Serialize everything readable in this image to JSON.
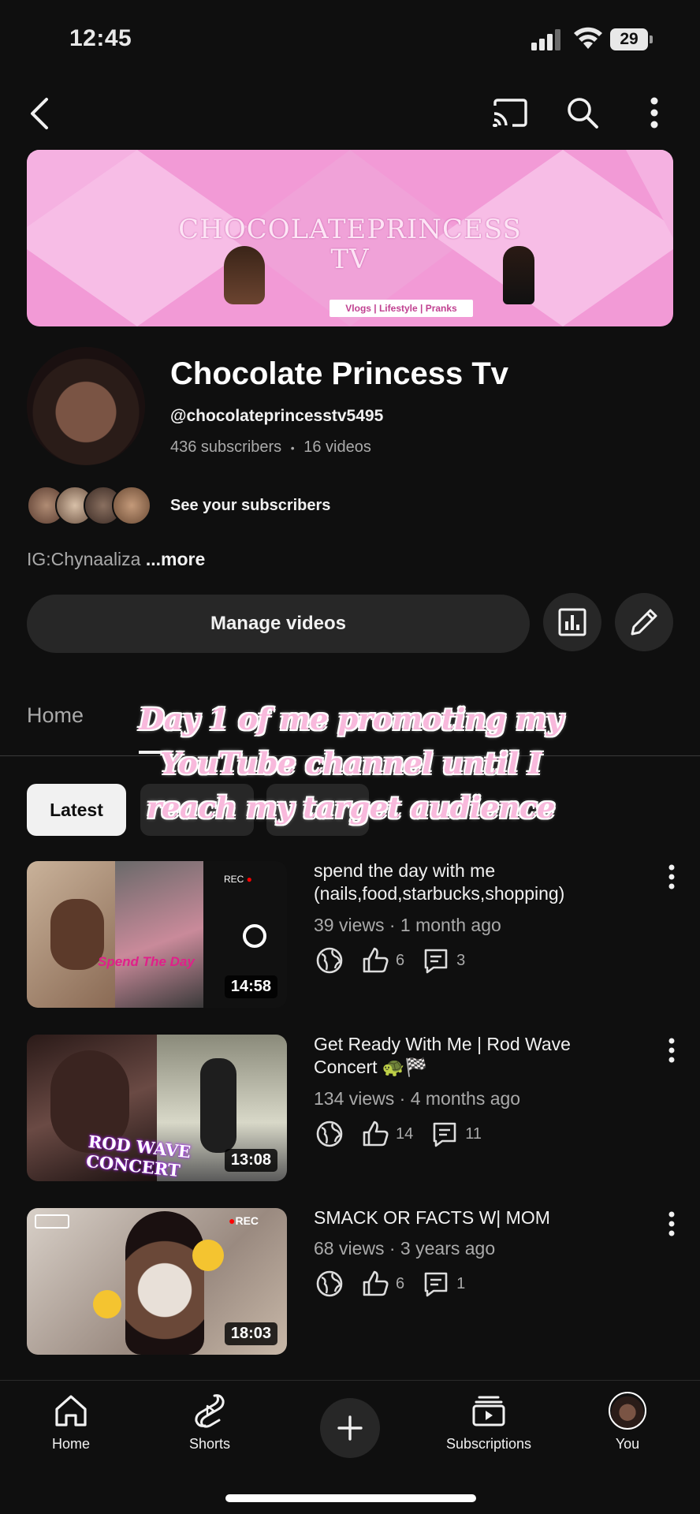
{
  "status_bar": {
    "time": "12:45",
    "battery": "29"
  },
  "banner": {
    "title_line1": "CHOCOLATEPRINCESS",
    "title_line2": "TV",
    "tagline": "Vlogs | Lifestyle | Pranks"
  },
  "channel": {
    "name": "Chocolate Princess Tv",
    "handle": "@chocolateprincesstv5495",
    "subscribers": "436 subscribers",
    "separator": "•",
    "videos_count": "16 videos",
    "see_subscribers": "See your subscribers",
    "description": "IG:Chynaaliza",
    "more": "...more"
  },
  "actions": {
    "manage_videos": "Manage videos"
  },
  "tabs": {
    "home": "Home"
  },
  "chips": {
    "latest": "Latest"
  },
  "overlay_caption": {
    "line1": "Day 1 of me promoting my",
    "line2": "YouTube channel until I",
    "line3": "reach my target audience"
  },
  "videos": [
    {
      "title": "spend the day with me (nails,food,starbucks,shopping)",
      "meta": "39 views · 1 month ago",
      "likes": "6",
      "comments": "3",
      "duration": "14:58",
      "overlay_text": "Spend The Day"
    },
    {
      "title": "Get Ready With Me | Rod Wave Concert 🐢🏁",
      "meta": "134 views · 4 months ago",
      "likes": "14",
      "comments": "11",
      "duration": "13:08",
      "overlay_text": "ROD WAVE CONCERT"
    },
    {
      "title": "SMACK OR FACTS W| MOM",
      "meta": "68 views · 3 years ago",
      "likes": "6",
      "comments": "1",
      "duration": "18:03",
      "overlay_text": "REC"
    }
  ],
  "bottom_nav": {
    "home": "Home",
    "shorts": "Shorts",
    "subscriptions": "Subscriptions",
    "you": "You"
  },
  "colors": {
    "background": "#0f0f0f",
    "surface": "#272727",
    "banner_pink": "#f29ad6",
    "caption_pink": "#f8b9dc"
  }
}
